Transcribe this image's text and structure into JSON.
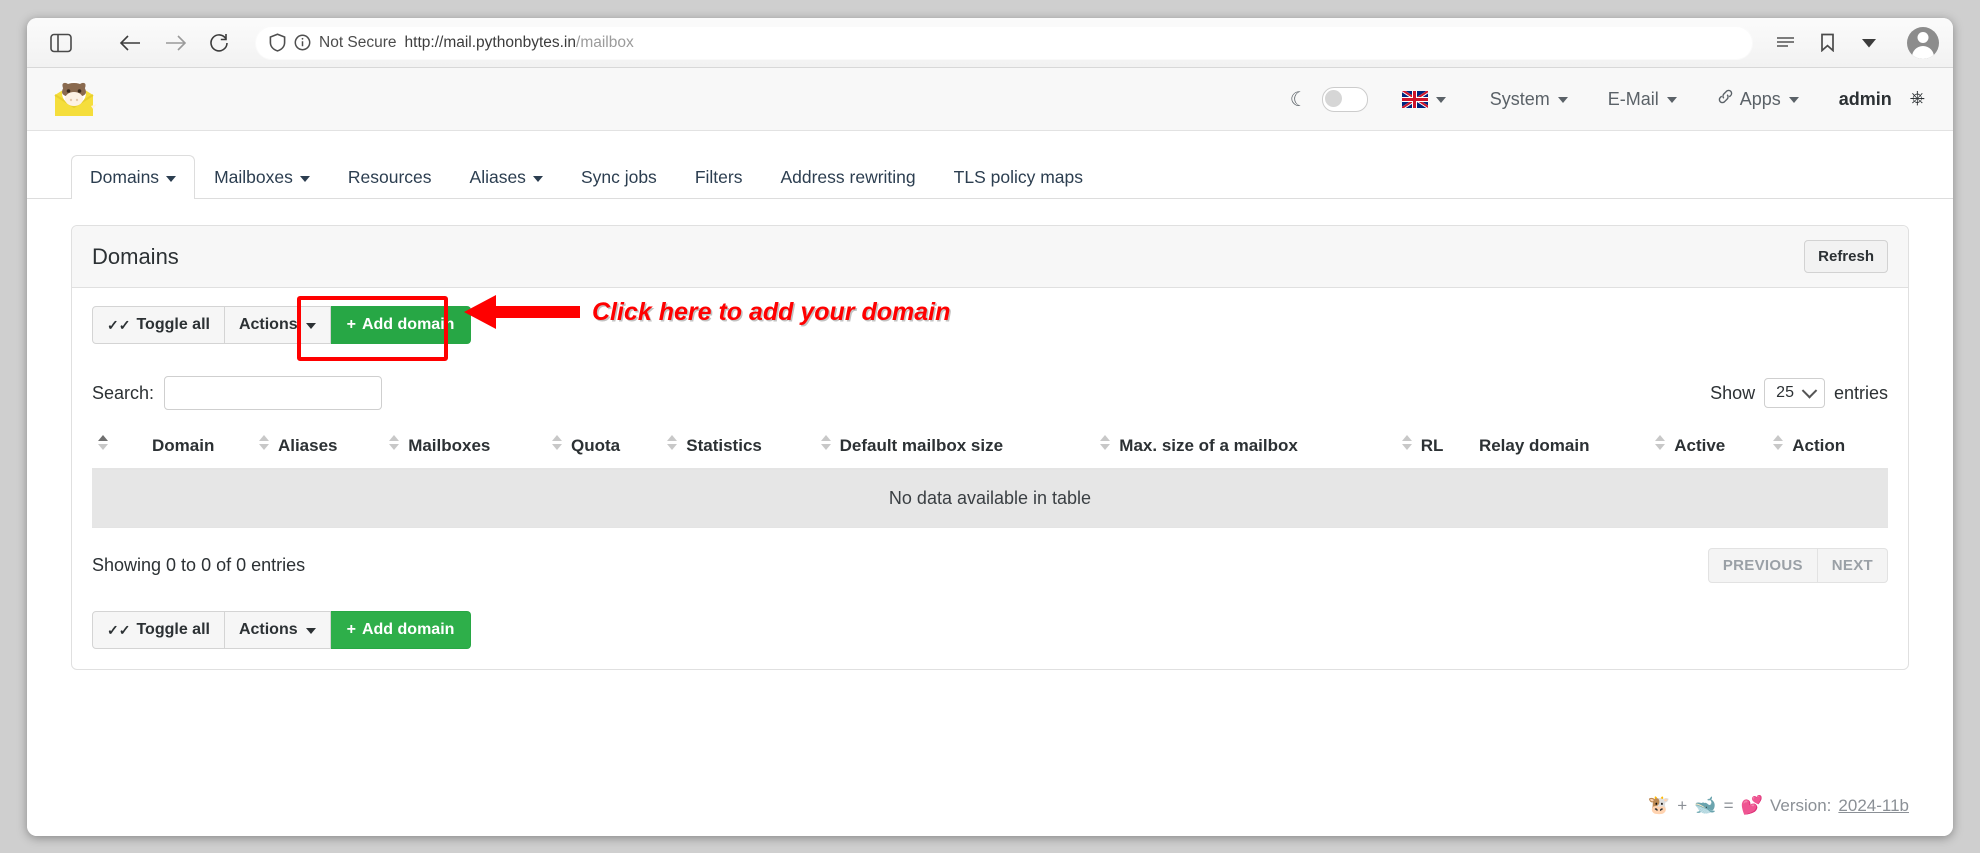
{
  "browser": {
    "security_label": "Not Secure",
    "url_host": "http://mail.pythonbytes.in",
    "url_path": "/mailbox",
    "icons": {
      "sidebar": "sidebar-toggle-icon",
      "back": "back-arrow-icon",
      "forward": "forward-arrow-icon",
      "reload": "reload-icon",
      "shield": "shield-icon",
      "info": "info-circle-icon",
      "reader": "reader-view-icon",
      "bookmark": "bookmark-icon",
      "chevron": "chevron-down-icon",
      "profile": "profile-avatar-icon"
    }
  },
  "navbar": {
    "logo_alt": "mailcow-logo",
    "dark_mode_icon": "moon-icon",
    "language": "en",
    "items": [
      {
        "label": "System",
        "caret": true
      },
      {
        "label": "E-Mail",
        "caret": true
      },
      {
        "label": "Apps",
        "caret": true
      },
      {
        "label": "admin",
        "caret": false
      }
    ],
    "apps_link_icon": "link-icon",
    "logout_icon": "power-icon"
  },
  "tabs": [
    {
      "label": "Domains",
      "caret": true,
      "active": true
    },
    {
      "label": "Mailboxes",
      "caret": true,
      "active": false
    },
    {
      "label": "Resources",
      "caret": false,
      "active": false
    },
    {
      "label": "Aliases",
      "caret": true,
      "active": false
    },
    {
      "label": "Sync jobs",
      "caret": false,
      "active": false
    },
    {
      "label": "Filters",
      "caret": false,
      "active": false
    },
    {
      "label": "Address rewriting",
      "caret": false,
      "active": false
    },
    {
      "label": "TLS policy maps",
      "caret": false,
      "active": false
    }
  ],
  "card": {
    "title": "Domains",
    "refresh_label": "Refresh"
  },
  "toolbar": {
    "toggle_all_label": "Toggle all",
    "toggle_all_icon": "double-check-icon",
    "actions_label": "Actions",
    "add_domain_label": "Add domain",
    "add_domain_plus": "+"
  },
  "annotation": {
    "text": "Click here to add your domain",
    "color": "#ff0000",
    "arrow": "left-arrow-annotation"
  },
  "search": {
    "label": "Search:",
    "value": "",
    "placeholder": ""
  },
  "show_entries": {
    "prefix": "Show",
    "value": "25",
    "suffix": "entries"
  },
  "table": {
    "columns": [
      {
        "label": "",
        "sortable": true
      },
      {
        "label": "Domain",
        "sortable": true
      },
      {
        "label": "Aliases",
        "sortable": true
      },
      {
        "label": "Mailboxes",
        "sortable": true
      },
      {
        "label": "Quota",
        "sortable": true
      },
      {
        "label": "Statistics",
        "sortable": true
      },
      {
        "label": "Default mailbox size",
        "sortable": true
      },
      {
        "label": "Max. size of a mailbox",
        "sortable": true
      },
      {
        "label": "RL",
        "sortable": false
      },
      {
        "label": "Relay domain",
        "sortable": true
      },
      {
        "label": "Active",
        "sortable": true
      },
      {
        "label": "Action",
        "sortable": false
      }
    ],
    "empty_text": "No data available in table",
    "rows": []
  },
  "pagination": {
    "showing": "Showing 0 to 0 of 0 entries",
    "previous": "PREVIOUS",
    "next": "NEXT"
  },
  "footer": {
    "cow": "🐮",
    "plus": "+",
    "whale": "🐋",
    "equals": "=",
    "heart": "💕",
    "version_label": "Version:",
    "version_value": "2024-11b"
  }
}
